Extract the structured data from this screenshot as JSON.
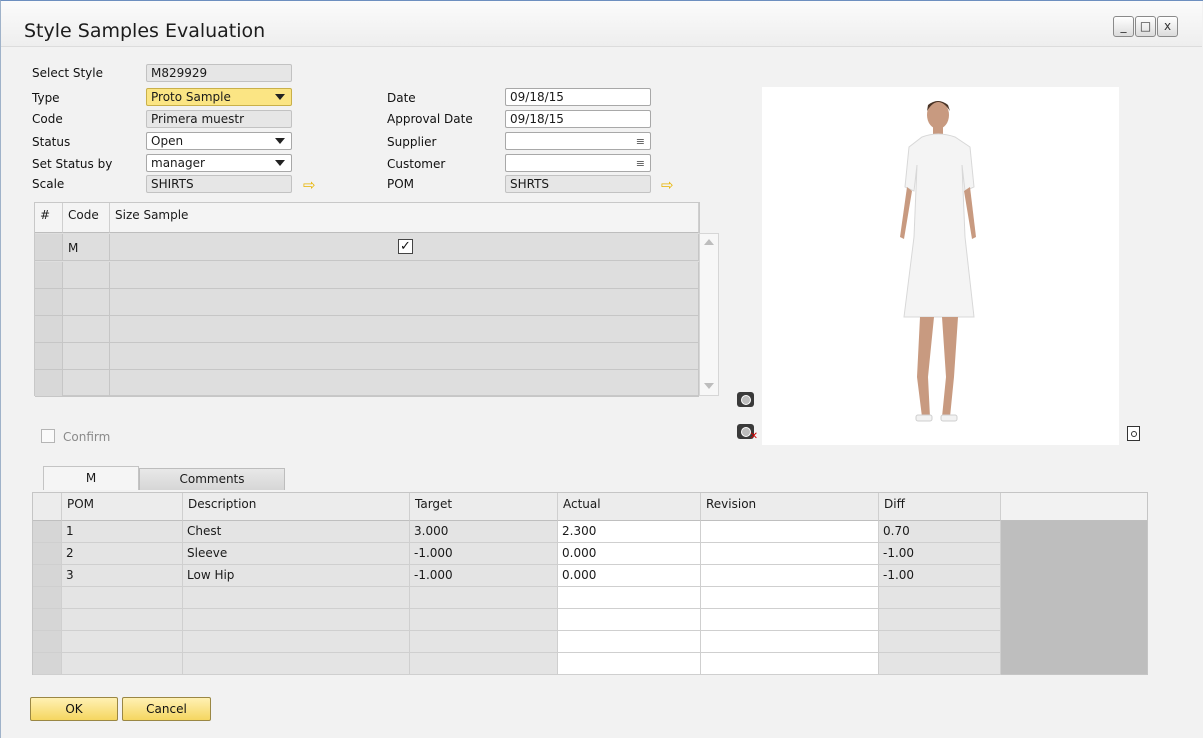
{
  "window": {
    "title": "Style Samples Evaluation",
    "controls": {
      "minimize": "_",
      "maximize": "□",
      "close": "x"
    }
  },
  "header": {
    "select_style": {
      "label": "Select Style",
      "value": "M829929"
    },
    "type": {
      "label": "Type",
      "value": "Proto Sample"
    },
    "code": {
      "label": "Code",
      "value": "Primera muestr"
    },
    "status": {
      "label": "Status",
      "value": "Open"
    },
    "set_status_by": {
      "label": "Set Status by",
      "value": "manager"
    },
    "scale": {
      "label": "Scale",
      "value": "SHIRTS"
    },
    "date": {
      "label": "Date",
      "value": "09/18/15"
    },
    "approval_date": {
      "label": "Approval Date",
      "value": "09/18/15"
    },
    "supplier": {
      "label": "Supplier",
      "value": ""
    },
    "customer": {
      "label": "Customer",
      "value": ""
    },
    "pom": {
      "label": "POM",
      "value": "SHRTS"
    }
  },
  "size_grid": {
    "columns": [
      "#",
      "Code",
      "Size Sample"
    ],
    "rows": [
      {
        "code": "M",
        "checked": true
      },
      {
        "code": ""
      },
      {
        "code": ""
      },
      {
        "code": ""
      },
      {
        "code": ""
      },
      {
        "code": ""
      }
    ]
  },
  "confirm": {
    "label": "Confirm",
    "checked": false
  },
  "tabs": [
    {
      "label": "M",
      "active": true
    },
    {
      "label": "Comments",
      "active": false
    }
  ],
  "measure_grid": {
    "columns": [
      "POM",
      "Description",
      "Target",
      "Actual",
      "Revision",
      "Diff"
    ],
    "rows": [
      {
        "pom": "1",
        "description": "Chest",
        "target": "3.000",
        "actual": "2.300",
        "revision": "",
        "diff": "0.70"
      },
      {
        "pom": "2",
        "description": "Sleeve",
        "target": "-1.000",
        "actual": "0.000",
        "revision": "",
        "diff": "-1.00"
      },
      {
        "pom": "3",
        "description": "Low Hip",
        "target": "-1.000",
        "actual": "0.000",
        "revision": "",
        "diff": "-1.00"
      },
      {
        "pom": "",
        "description": "",
        "target": "",
        "actual": "",
        "revision": "",
        "diff": ""
      },
      {
        "pom": "",
        "description": "",
        "target": "",
        "actual": "",
        "revision": "",
        "diff": ""
      },
      {
        "pom": "",
        "description": "",
        "target": "",
        "actual": "",
        "revision": "",
        "diff": ""
      },
      {
        "pom": "",
        "description": "",
        "target": "",
        "actual": "",
        "revision": "",
        "diff": ""
      }
    ]
  },
  "buttons": {
    "ok": "OK",
    "cancel": "Cancel"
  },
  "colors": {
    "accent_yellow": "#f5d660",
    "arrow": "#e8b400"
  }
}
